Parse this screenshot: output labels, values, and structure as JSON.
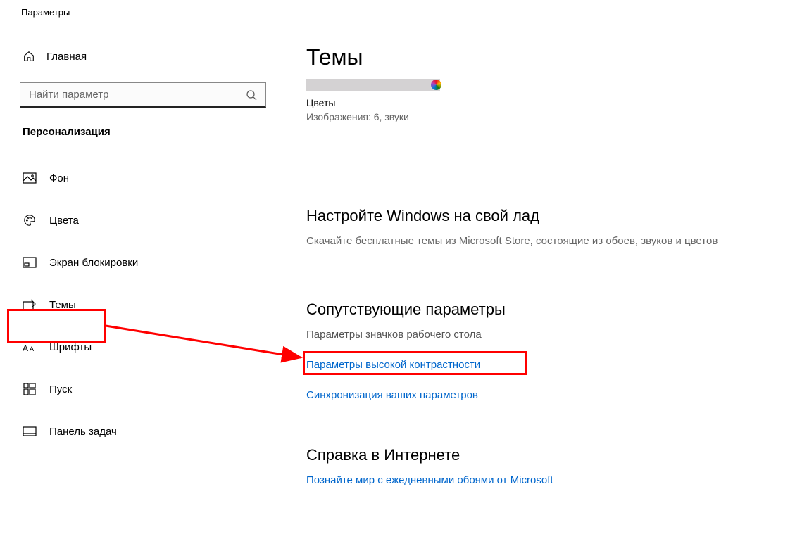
{
  "window": {
    "title": "Параметры"
  },
  "sidebar": {
    "home_label": "Главная",
    "search_placeholder": "Найти параметр",
    "section_header": "Персонализация",
    "items": [
      {
        "label": "Фон"
      },
      {
        "label": "Цвета"
      },
      {
        "label": "Экран блокировки"
      },
      {
        "label": "Темы"
      },
      {
        "label": "Шрифты"
      },
      {
        "label": "Пуск"
      },
      {
        "label": "Панель задач"
      }
    ]
  },
  "main": {
    "title": "Темы",
    "theme": {
      "name": "Цветы",
      "meta": "Изображения: 6, звуки"
    },
    "customize": {
      "title": "Настройте Windows на свой лад",
      "desc": "Скачайте бесплатные темы из Microsoft Store, состоящие из обоев, звуков и цветов"
    },
    "related": {
      "title": "Сопутствующие параметры",
      "links": [
        "Параметры значков рабочего стола",
        "Параметры высокой контрастности",
        "Синхронизация ваших параметров"
      ]
    },
    "help": {
      "title": "Справка в Интернете",
      "link": "Познайте мир с ежедневными обоями от Microsoft"
    }
  }
}
